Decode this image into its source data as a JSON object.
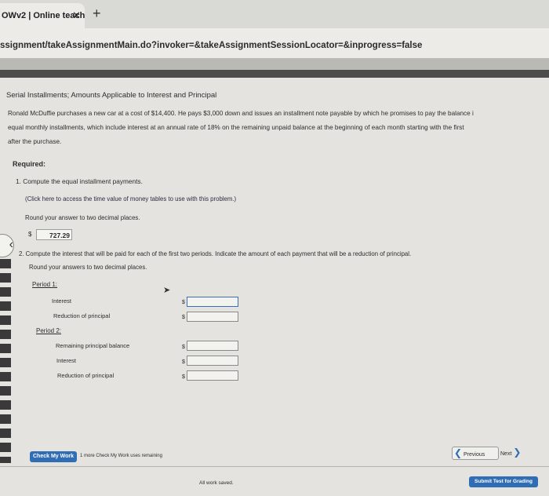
{
  "browser": {
    "tab_title": "OWv2 | Online teach",
    "tab_close": "✕",
    "new_tab": "+",
    "url": "ssignment/takeAssignmentMain.do?invoker=&takeAssignmentSessionLocator=&inprogress=false"
  },
  "problem": {
    "heading": "Serial Installments; Amounts Applicable to Interest and Principal",
    "intro_lines": [
      "Ronald McDuffie purchases a new car at a cost of $14,400. He pays $3,000 down and issues an installment note payable by which he promises to pay the balance i",
      "equal monthly installments, which include interest at an annual rate of 18% on the remaining unpaid balance at the beginning of each month starting with the first",
      "after the purchase."
    ],
    "required_label": "Required:",
    "q1_text": "1. Compute the equal installment payments.",
    "q1_link": "(Click here to access the time value of money tables to use with this problem.)",
    "q1_round": "Round your answer to two decimal places.",
    "q1_currency": "$",
    "q1_answer": "727.29",
    "q2_text": "2. Compute the interest that will be paid for each of the first two periods. Indicate the amount of each payment that will be a reduction of principal.",
    "q2_round": "Round your answers to two decimal places.",
    "period1_label": "Period 1:",
    "period1_rows": [
      {
        "label": "Interest",
        "currency": "$",
        "value": ""
      },
      {
        "label": "Reduction of principal",
        "currency": "$",
        "value": ""
      }
    ],
    "period2_label": "Period 2:",
    "period2_rows": [
      {
        "label": "Remaining principal balance",
        "currency": "$",
        "value": ""
      },
      {
        "label": "Interest",
        "currency": "$",
        "value": ""
      },
      {
        "label": "Reduction of principal",
        "currency": "$",
        "value": ""
      }
    ]
  },
  "footer": {
    "check_button": "Check My Work",
    "check_remaining": "1 more Check My Work uses remaining",
    "previous_button": "Previous",
    "next_button": "Next",
    "saved_status": "All work saved.",
    "submit_button": "Submit Test for Grading"
  },
  "colors": {
    "accent": "#2f6db5",
    "input_focus_border": "#3d6fb8"
  }
}
